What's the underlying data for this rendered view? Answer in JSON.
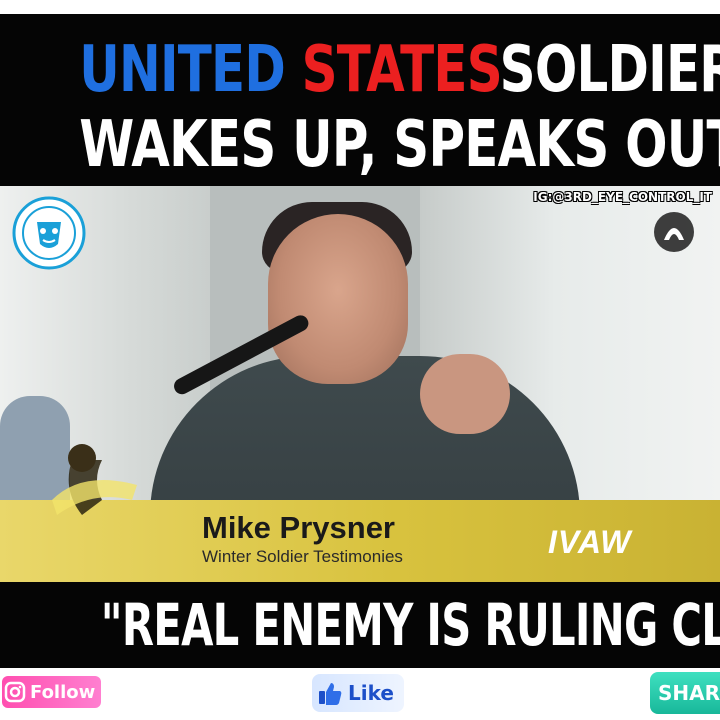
{
  "headline": {
    "line1_words": [
      "UNITED",
      "STATES",
      "SOLDIER"
    ],
    "line2": "WAKES UP, SPEAKS OUT"
  },
  "watermark": {
    "ig_handle": "IG:@3RD_EYE_CONTROL_IT"
  },
  "lower_third": {
    "name": "Mike Prysner",
    "subtitle": "Winter Soldier Testimonies",
    "org": "IVAW"
  },
  "quote": "\"REAL ENEMY IS RULING CLASS\"",
  "social": {
    "follow_label": "Follow",
    "like_label": "Like",
    "share_label": "SHARE"
  },
  "colors": {
    "headline_blue": "#1f6fe0",
    "headline_red": "#ec2020",
    "band_black": "#050505",
    "lower_third_yellow": "#d8c23e"
  },
  "icons": [
    "instagram-icon",
    "thumbs-up-icon",
    "share-icon",
    "channel-logo",
    "corner-logo"
  ]
}
